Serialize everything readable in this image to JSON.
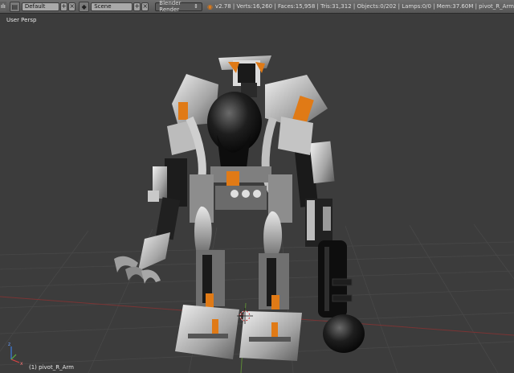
{
  "header": {
    "editor_fragment": "ılı",
    "screen_layout": "Default",
    "scene": "Scene",
    "render_engine": "Blender Render",
    "stats": "v2.78 | Verts:16,260 | Faces:15,958 | Tris:31,312 | Objects:0/202 | Lamps:0/0 | Mem:37.60M | pivot_R_Arm"
  },
  "viewport": {
    "view_label": "User Persp",
    "object_label": "(1) pivot_R_Arm"
  },
  "colors": {
    "accent_orange": "#e07a16",
    "background": "#3c3c3c",
    "grid": "#4a4a4a",
    "x_axis": "#8a3a3a",
    "y_axis": "#5f8f3a"
  }
}
